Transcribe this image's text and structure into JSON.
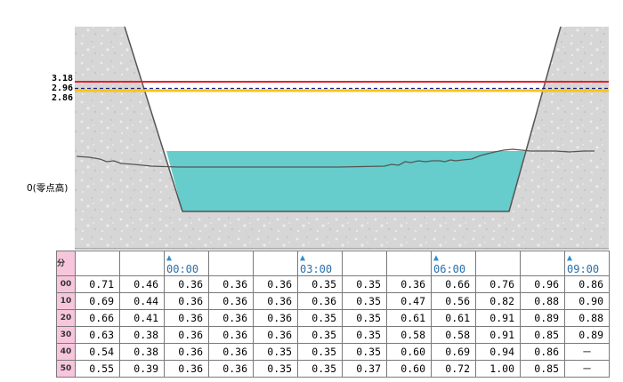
{
  "levels": {
    "red_line": "3.18",
    "dashed_line": "2.96",
    "yellow_line": "2.86",
    "zero_label": "0(零点高)"
  },
  "colors": {
    "red_line": "#e8202a",
    "dashed_line": "#1a1a8a",
    "yellow_line": "#f5c518",
    "water": "#66cccc",
    "bank": "#d4d4d4",
    "minute_header_bg": "#f7c6dc",
    "time_label": "#2a6fa8"
  },
  "table": {
    "minute_header": "分",
    "marker": "▲",
    "time_labels": [
      "00:00",
      "",
      "",
      "03:00",
      "",
      "",
      "06:00",
      "",
      "",
      "09:00"
    ],
    "time_columns": [
      2,
      5,
      8,
      11
    ],
    "rows": [
      {
        "minute": "00",
        "values": [
          "0.71",
          "0.46",
          "0.36",
          "0.36",
          "0.36",
          "0.35",
          "0.35",
          "0.36",
          "0.66",
          "0.76",
          "0.96",
          "0.86"
        ]
      },
      {
        "minute": "10",
        "values": [
          "0.69",
          "0.44",
          "0.36",
          "0.36",
          "0.36",
          "0.36",
          "0.35",
          "0.47",
          "0.56",
          "0.82",
          "0.88",
          "0.90"
        ]
      },
      {
        "minute": "20",
        "values": [
          "0.66",
          "0.41",
          "0.36",
          "0.36",
          "0.36",
          "0.35",
          "0.35",
          "0.61",
          "0.61",
          "0.91",
          "0.89",
          "0.88"
        ]
      },
      {
        "minute": "30",
        "values": [
          "0.63",
          "0.38",
          "0.36",
          "0.36",
          "0.36",
          "0.35",
          "0.35",
          "0.58",
          "0.58",
          "0.91",
          "0.85",
          "0.89"
        ]
      },
      {
        "minute": "40",
        "values": [
          "0.54",
          "0.38",
          "0.36",
          "0.36",
          "0.35",
          "0.35",
          "0.35",
          "0.60",
          "0.69",
          "0.94",
          "0.86",
          "－"
        ]
      },
      {
        "minute": "50",
        "values": [
          "0.55",
          "0.39",
          "0.36",
          "0.36",
          "0.35",
          "0.35",
          "0.37",
          "0.60",
          "0.72",
          "1.00",
          "0.85",
          "－"
        ]
      }
    ]
  }
}
